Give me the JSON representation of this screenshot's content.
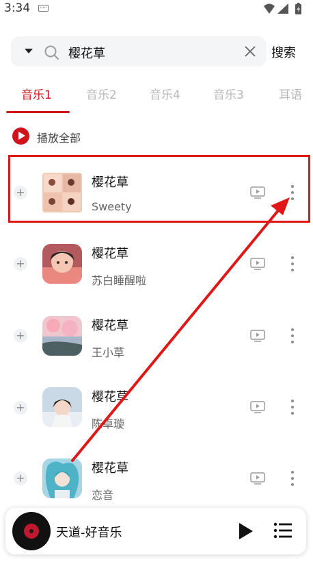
{
  "status_bar": {
    "time": "3:34",
    "icons": [
      "keyboard-icon",
      "wifi-icon",
      "signal-icon",
      "battery-icon"
    ]
  },
  "search": {
    "query": "樱花草",
    "button_label": "搜索",
    "icons": [
      "dropdown-icon",
      "search-icon",
      "clear-icon"
    ]
  },
  "tabs": [
    {
      "label": "音乐1",
      "active": true
    },
    {
      "label": "音乐2",
      "active": false
    },
    {
      "label": "音乐4",
      "active": false
    },
    {
      "label": "音乐3",
      "active": false
    },
    {
      "label": "耳语",
      "active": false
    }
  ],
  "play_all_label": "播放全部",
  "songs": [
    {
      "title": "樱花草",
      "artist": "Sweety"
    },
    {
      "title": "樱花草",
      "artist": "苏白睡醒啦"
    },
    {
      "title": "樱花草",
      "artist": "王小草"
    },
    {
      "title": "樱花草",
      "artist": "陈卓璇"
    },
    {
      "title": "樱花草",
      "artist": "恋音"
    }
  ],
  "mini_player": {
    "now_playing": "天道-好音乐"
  },
  "colors": {
    "accent": "#d0121b",
    "annotation": "#e01717",
    "tab_inactive": "#b8b8b8"
  }
}
